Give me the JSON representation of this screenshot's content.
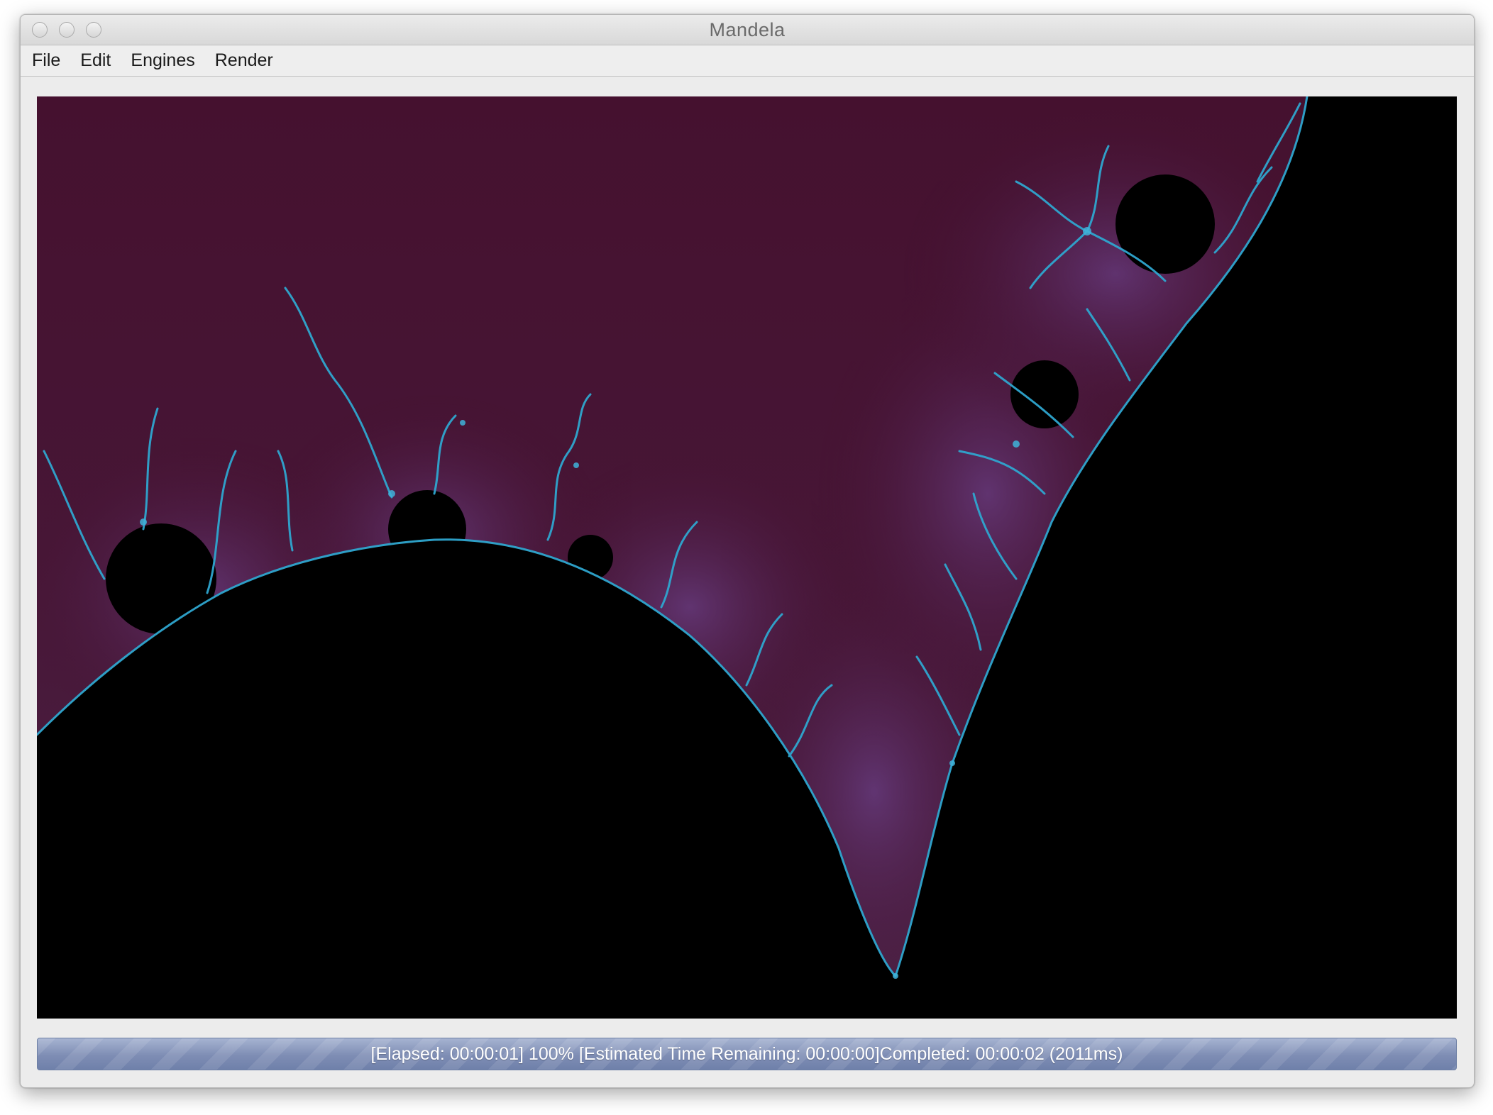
{
  "window": {
    "title": "Mandela"
  },
  "menu": {
    "items": [
      {
        "label": "File"
      },
      {
        "label": "Edit"
      },
      {
        "label": "Engines"
      },
      {
        "label": "Render"
      }
    ]
  },
  "render": {
    "colors": {
      "exterior": "#45112f",
      "exterior_glow": "#5a2f6e",
      "boundary": "#2fa6cf",
      "interior": "#000000"
    }
  },
  "status": {
    "text": "[Elapsed: 00:00:01] 100% [Estimated Time Remaining: 00:00:00]Completed: 00:00:02 (2011ms)",
    "progress": 1.0
  }
}
